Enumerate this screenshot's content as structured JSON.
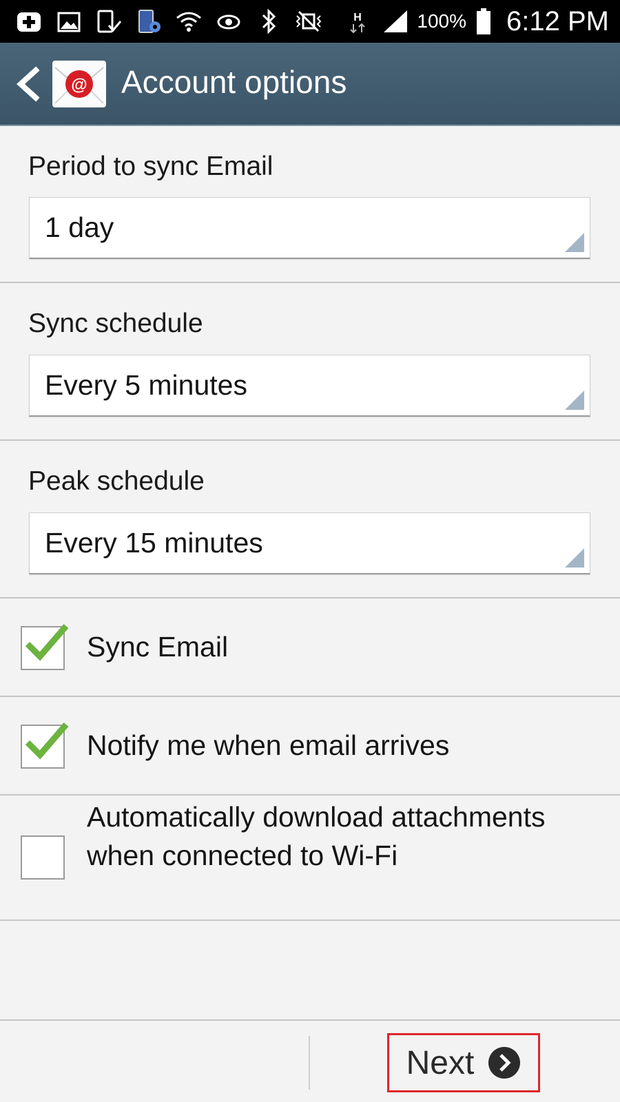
{
  "status_bar": {
    "icons": [
      "add-icon",
      "image-icon",
      "phone-check-icon",
      "phone-settings-icon",
      "wifi-icon",
      "eye-icon",
      "bluetooth-icon",
      "vibrate-icon",
      "network-h-icon",
      "signal-icon",
      "battery-icon"
    ],
    "battery": "100%",
    "time": "6:12 PM"
  },
  "header": {
    "title": "Account options",
    "icons": [
      "back-icon",
      "email-app-icon"
    ]
  },
  "settings": {
    "period_label": "Period to sync Email",
    "period_value": "1 day",
    "sync_label": "Sync schedule",
    "sync_value": "Every 5 minutes",
    "peak_label": "Peak schedule",
    "peak_value": "Every 15 minutes"
  },
  "options": [
    {
      "label": "Sync Email",
      "checked": true
    },
    {
      "label": "Notify me when email arrives",
      "checked": true
    },
    {
      "label": "Automatically download attachments when connected to Wi-Fi",
      "checked": false
    }
  ],
  "footer": {
    "next_label": "Next",
    "next_icon": "chevron-right-circle-icon"
  },
  "colors": {
    "header": "#3f5a6c",
    "check_green": "#6cb33f",
    "highlight": "#e0262c"
  }
}
